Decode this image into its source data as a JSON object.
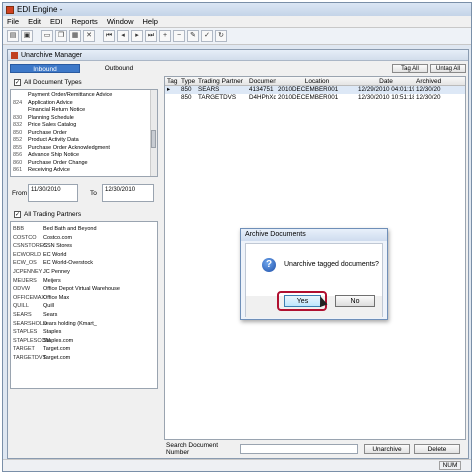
{
  "app": {
    "title": "EDI Engine -"
  },
  "menu": [
    "File",
    "Edit",
    "EDI",
    "Reports",
    "Window",
    "Help"
  ],
  "window": {
    "title": "Unarchive Manager"
  },
  "tabs": {
    "inbound": "Inbound",
    "outbound": "Outbound"
  },
  "doc_types": {
    "all_label": "All Document Types",
    "items": [
      {
        "code": "",
        "name": "Payment Order/Remittance Advice"
      },
      {
        "code": "824",
        "name": "Application Advice"
      },
      {
        "code": "",
        "name": "Financial Return Notice"
      },
      {
        "code": "830",
        "name": "Planning Schedule"
      },
      {
        "code": "832",
        "name": "Price Sales Catalog"
      },
      {
        "code": "850",
        "name": "Purchase Order"
      },
      {
        "code": "852",
        "name": "Product Activity Data"
      },
      {
        "code": "855",
        "name": "Purchase Order Acknowledgment"
      },
      {
        "code": "856",
        "name": "Advance Ship Notice"
      },
      {
        "code": "860",
        "name": "Purchase Order Change"
      },
      {
        "code": "861",
        "name": "Receiving Advice"
      }
    ]
  },
  "dates": {
    "from_label": "From",
    "from_value": "11/30/2010",
    "to_label": "To",
    "to_value": "12/30/2010"
  },
  "partners": {
    "all_label": "All Trading Partners",
    "items": [
      {
        "code": "BBB",
        "name": "Bed Bath and Beyond"
      },
      {
        "code": "COSTCO",
        "name": "Costco.com"
      },
      {
        "code": "CSNSTORES",
        "name": "CSN Stores"
      },
      {
        "code": "ECWORLD",
        "name": "EC World"
      },
      {
        "code": "ECW_OS",
        "name": "EC World-Overstock"
      },
      {
        "code": "JCPENNEY",
        "name": "JC Penney"
      },
      {
        "code": "MEIJERS",
        "name": "Meijers"
      },
      {
        "code": "ODVW",
        "name": "Office Depot Virtual Warehouse"
      },
      {
        "code": "OFFICEMAX",
        "name": "Office Max"
      },
      {
        "code": "QUILL",
        "name": "Quill"
      },
      {
        "code": "SEARS",
        "name": "Sears"
      },
      {
        "code": "SEARSHOLD",
        "name": "sears holding (Kmart_"
      },
      {
        "code": "STAPLES",
        "name": "Staples"
      },
      {
        "code": "STAPLESCOM",
        "name": "Staples.com"
      },
      {
        "code": "TARGET",
        "name": "Target.com"
      },
      {
        "code": "TARGETDVS",
        "name": "Target.com"
      }
    ]
  },
  "buttons": {
    "tag_all": "Tag All",
    "untag_all": "Untag All",
    "unarchive": "Unarchive",
    "delete": "Delete"
  },
  "grid": {
    "headers": [
      "Tag",
      "Type",
      "Trading Partner",
      "Document",
      "Location",
      "Date",
      "Archived"
    ],
    "rows": [
      {
        "tag": "",
        "type": "850",
        "partner": "SEARS",
        "document": "4134751",
        "location": "2010DECEMBER001",
        "date": "12/29/2010 04:01:19 PM",
        "archived": "12/30/20"
      },
      {
        "tag": "",
        "type": "850",
        "partner": "TARGETDVS",
        "document": "D4HPhXqtR",
        "location": "2010DECEMBER001",
        "date": "12/30/2010 10:51:18 AM",
        "archived": "12/30/20"
      }
    ]
  },
  "search": {
    "label": "Search Document Number"
  },
  "status": {
    "num": "NUM"
  },
  "dialog": {
    "title": "Archive Documents",
    "message": "Unarchive tagged documents?",
    "yes": "Yes",
    "no": "No"
  }
}
